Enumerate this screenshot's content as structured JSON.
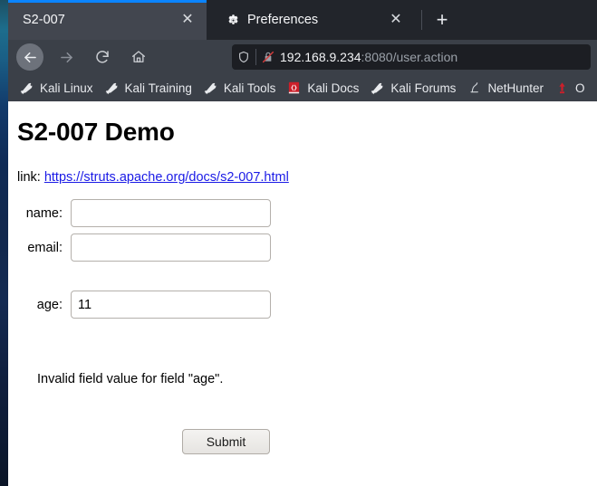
{
  "browser": {
    "tabs": [
      {
        "title": "S2-007",
        "favicon": "none",
        "active": true,
        "close_label": "✕"
      },
      {
        "title": "Preferences",
        "favicon": "gear-icon",
        "active": false,
        "close_label": "✕"
      }
    ],
    "newtab_label": "+",
    "nav": {
      "back_label": "←",
      "forward_label": "→",
      "reload_label": "⟳",
      "home_label": "home-icon"
    },
    "urlbar": {
      "shield_icon": "shield-icon",
      "lock_icon": "lock-crossed-icon",
      "host": "192.168.9.234",
      "rest": ":8080/user.action",
      "full_url": "192.168.9.234:8080/user.action"
    },
    "bookmarks": [
      {
        "label": "Kali Linux",
        "icon": "dragon-wrench-icon"
      },
      {
        "label": "Kali Training",
        "icon": "dragon-wrench-icon"
      },
      {
        "label": "Kali Tools",
        "icon": "dragon-wrench-icon"
      },
      {
        "label": "Kali Docs",
        "icon": "red-book-icon"
      },
      {
        "label": "Kali Forums",
        "icon": "dragon-wrench-icon"
      },
      {
        "label": "NetHunter",
        "icon": "nethunter-hook-icon"
      },
      {
        "label": "O",
        "icon": "red-tower-icon"
      }
    ]
  },
  "page": {
    "title": "S2-007 Demo",
    "link_prefix": "link:",
    "link_text": "https://struts.apache.org/docs/s2-007.html",
    "fields": [
      {
        "label": "name:",
        "value": "",
        "placeholder": ""
      },
      {
        "label": "email:",
        "value": "",
        "placeholder": ""
      },
      {
        "label": "age:",
        "value": "11",
        "placeholder": ""
      }
    ],
    "error_message": "Invalid field value for field \"age\".",
    "submit_label": "Submit"
  },
  "colors": {
    "tab_active_bg": "#42464f",
    "tab_inactive_bg": "#22252b",
    "tab_accent": "#0a84ff",
    "chrome_bg": "#3b4048",
    "urlbar_bg": "#1c1e23",
    "link": "#1a1ae6"
  }
}
